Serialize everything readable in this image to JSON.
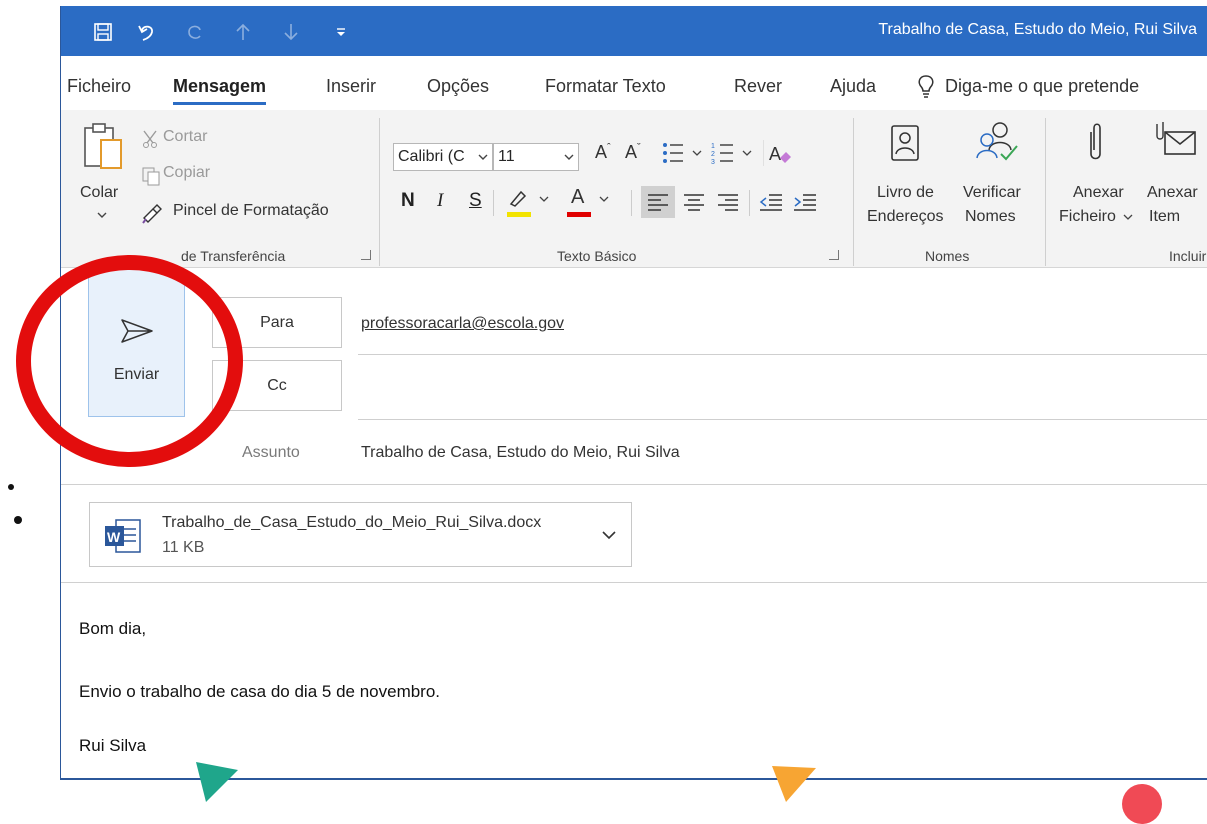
{
  "window": {
    "title": "Trabalho de Casa, Estudo do Meio, Rui Silva"
  },
  "quick_access": {
    "icons": [
      "save-icon",
      "undo-icon",
      "redo-icon",
      "up-icon",
      "down-icon",
      "customize-icon"
    ]
  },
  "ribbon_tabs": [
    "Ficheiro",
    "Mensagem",
    "Inserir",
    "Opções",
    "Formatar Texto",
    "Rever",
    "Ajuda"
  ],
  "active_tab": "Mensagem",
  "tell_me": "Diga-me o que pretende",
  "clipboard": {
    "paste": "Colar",
    "cut": "Cortar",
    "copy": "Copiar",
    "format_painter": "Pincel de Formatação",
    "group_label": "de Transferência"
  },
  "basic_text": {
    "font_name": "Calibri (C",
    "font_size": "11",
    "bold": "N",
    "italic": "I",
    "underline": "S",
    "group_label": "Texto Básico",
    "highlight_color": "#f2e300",
    "font_color": "#e00000"
  },
  "names": {
    "address_book_line1": "Livro de",
    "address_book_line2": "Endereços",
    "check_names_line1": "Verificar",
    "check_names_line2": "Nomes",
    "group_label": "Nomes"
  },
  "include": {
    "attach_file_line1": "Anexar",
    "attach_file_line2": "Ficheiro",
    "attach_item_line1": "Anexar",
    "attach_item_line2": "Item",
    "group_label": "Incluir"
  },
  "compose": {
    "send_label": "Enviar",
    "to_label": "Para",
    "cc_label": "Cc",
    "subject_label": "Assunto",
    "to_value": "professoracarla@escola.gov",
    "cc_value": "",
    "subject_value": "Trabalho de Casa, Estudo do Meio, Rui Silva"
  },
  "attachment": {
    "name": "Trabalho_de_Casa_Estudo_do_Meio_Rui_Silva.docx",
    "size": "11 KB",
    "icon_letter": "W"
  },
  "body": {
    "greeting": "Bom dia,",
    "line1": "Envio o trabalho de casa do dia 5 de novembro.",
    "signature": "Rui Silva"
  },
  "colors": {
    "accent": "#2b6cc4",
    "annotation_red": "#e30d0d",
    "triangle_teal": "#1fa68b",
    "triangle_orange": "#f7a533",
    "dot_red": "#f04a55"
  }
}
